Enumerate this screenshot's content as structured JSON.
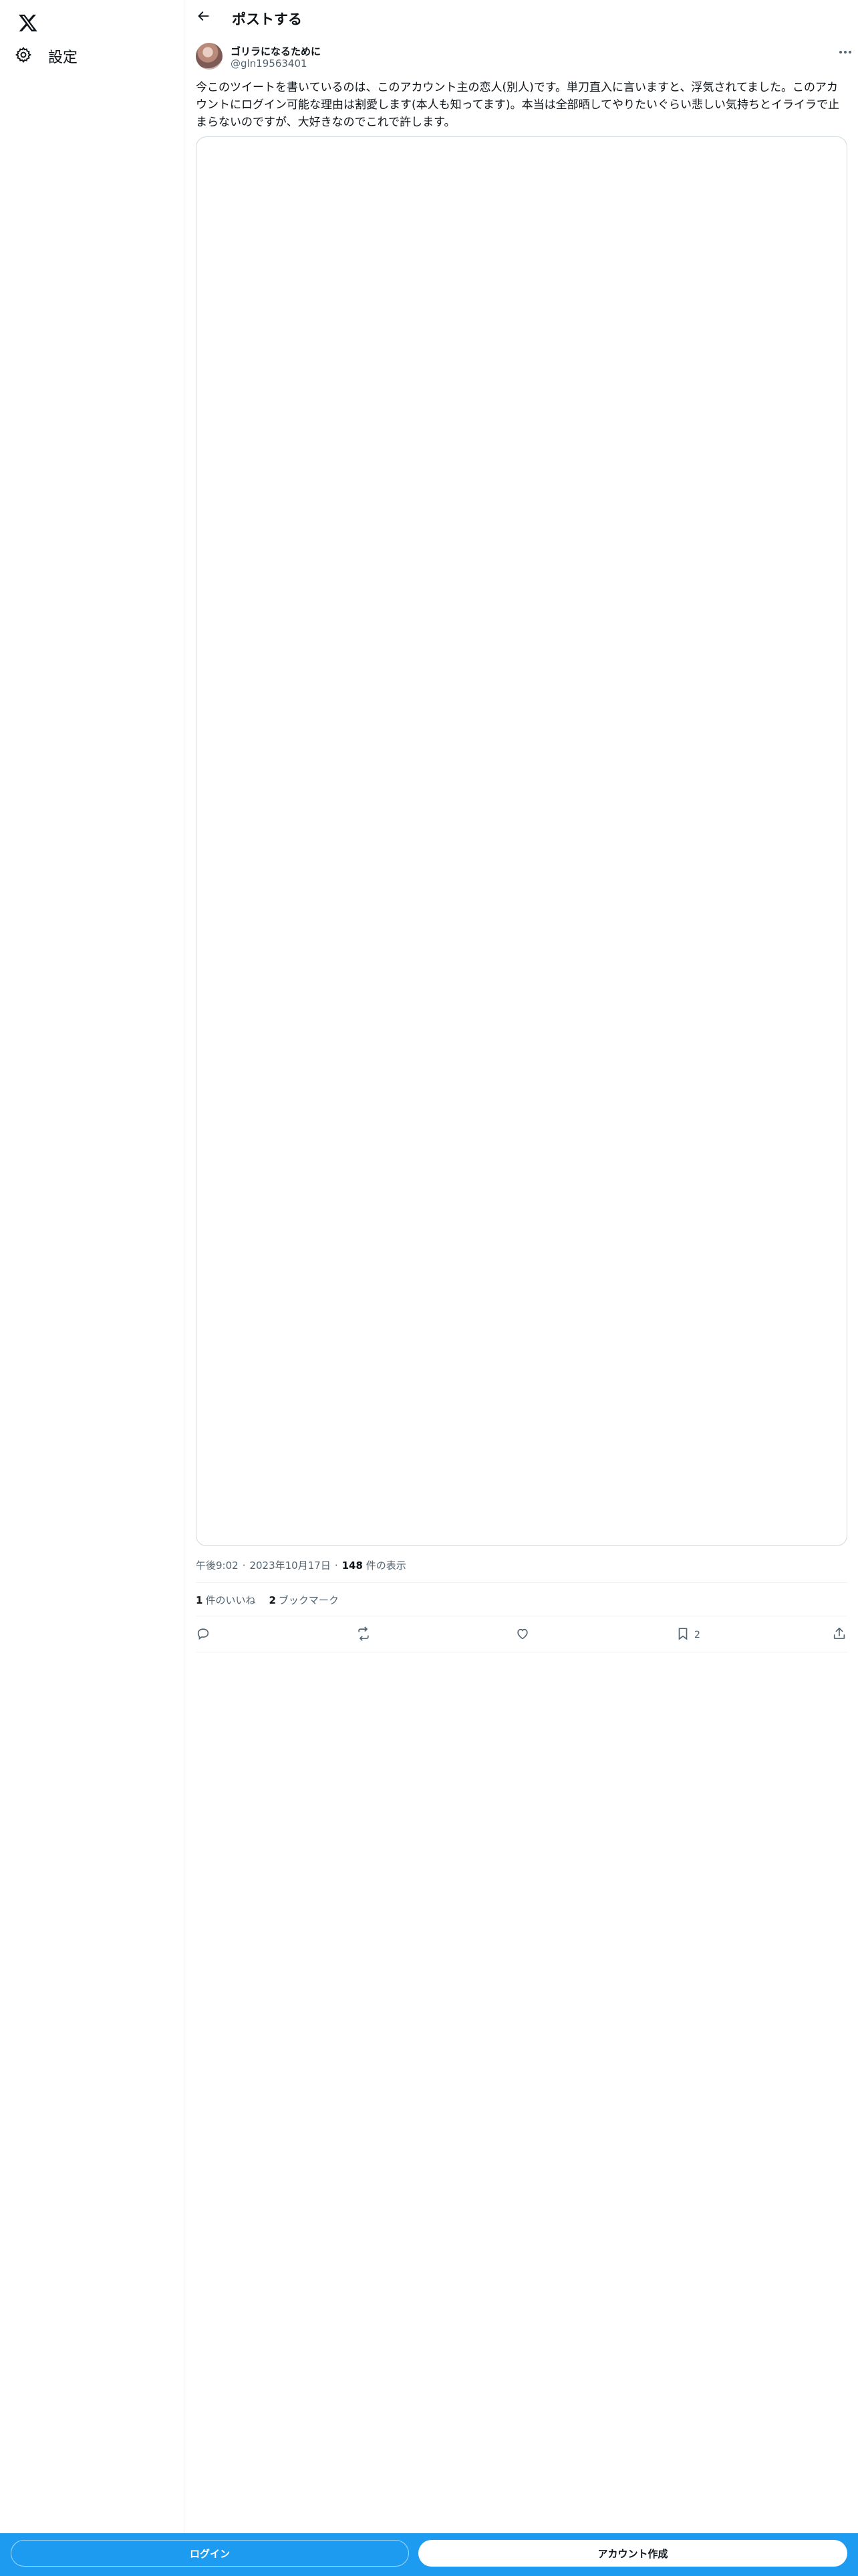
{
  "sidebar": {
    "logo_icon": "x-logo-icon",
    "items": [
      {
        "label": "設定",
        "icon": "gear-icon"
      }
    ]
  },
  "header": {
    "back_icon": "back-arrow-icon",
    "title": "ポストする"
  },
  "post": {
    "author_name": "ゴリラになるために",
    "author_handle": "@gln19563401",
    "text": "今このツイートを書いているのは、このアカウント主の恋人(別人)です。単刀直入に言いますと、浮気されてました。このアカウントにログイン可能な理由は割愛します(本人も知ってます)。本当は全部晒してやりたいぐらい悲しい気持ちとイライラで止まらないのですが、大好きなのでこれで許します。",
    "time": "午後9:02",
    "date": "2023年10月17日",
    "separator": "·",
    "views_count": "148",
    "views_label": "件の表示",
    "likes_count": "1",
    "likes_label": "件のいいね",
    "bookmarks_count": "2",
    "bookmarks_label": "ブックマーク",
    "actions": {
      "reply_icon": "reply-icon",
      "repost_icon": "repost-icon",
      "like_icon": "heart-icon",
      "bookmark_icon": "bookmark-icon",
      "bookmark_count": "2",
      "share_icon": "share-icon"
    }
  },
  "bottom_bar": {
    "login_label": "ログイン",
    "signup_label": "アカウント作成",
    "background_color": "#1d9bf0"
  }
}
